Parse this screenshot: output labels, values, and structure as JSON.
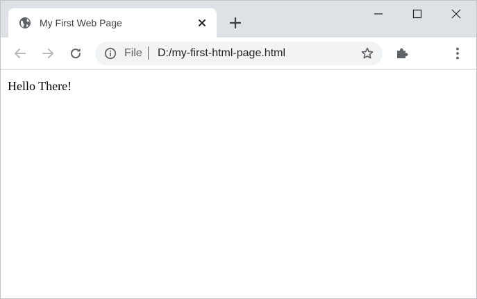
{
  "tab": {
    "title": "My First Web Page",
    "favicon_icon": "globe-icon",
    "close_icon": "close-icon"
  },
  "tabstrip": {
    "new_tab_icon": "plus-icon"
  },
  "window_controls": {
    "minimize_icon": "minimize-icon",
    "maximize_icon": "maximize-icon",
    "close_icon": "close-icon"
  },
  "toolbar": {
    "back_icon": "arrow-left-icon",
    "forward_icon": "arrow-right-icon",
    "reload_icon": "reload-icon",
    "extensions_icon": "puzzle-icon",
    "menu_icon": "kebab-menu-icon"
  },
  "omnibox": {
    "info_icon": "info-icon",
    "scheme_label": "File",
    "url": "D:/my-first-html-page.html",
    "bookmark_icon": "star-icon"
  },
  "page": {
    "text": "Hello There!"
  },
  "colors": {
    "tabstrip_bg": "#dee1e6",
    "omnibox_bg": "#f1f3f4",
    "icon_gray": "#5f6368",
    "icon_disabled": "#b7b9bc"
  }
}
